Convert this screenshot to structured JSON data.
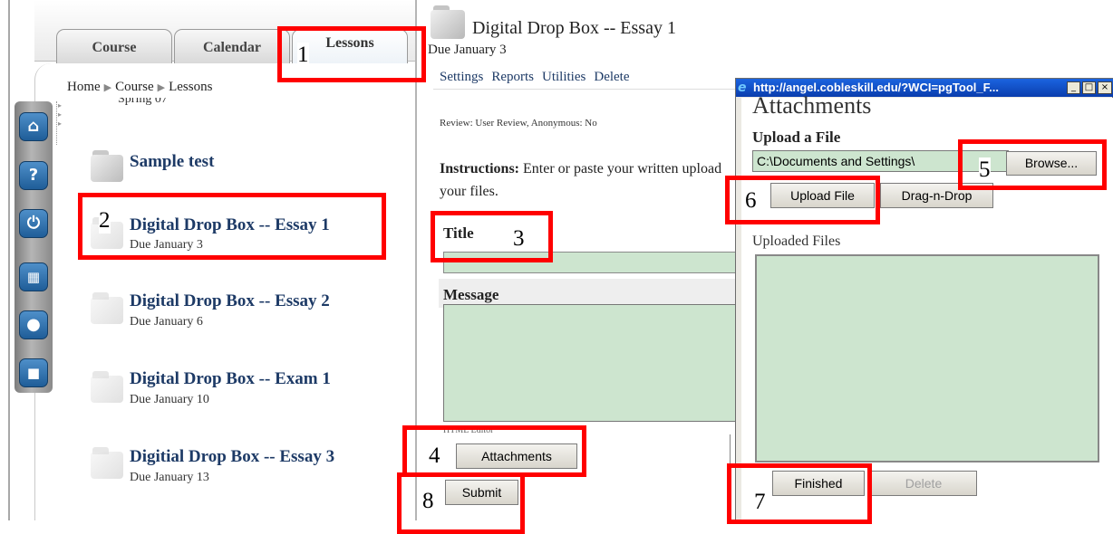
{
  "left": {
    "tabs": [
      {
        "label": "Course"
      },
      {
        "label": "Calendar"
      },
      {
        "label": "Lessons"
      }
    ],
    "breadcrumb": [
      "Home",
      "Course",
      "Lessons"
    ],
    "cut_text": "Spring 07",
    "sidebar_icons": [
      "home-icon",
      "help-icon",
      "power-icon",
      "folder-icon",
      "user-icon",
      "chat-icon"
    ],
    "lessons": [
      {
        "title": "Sample test",
        "due": ""
      },
      {
        "title": "Digital Drop Box -- Essay 1",
        "due": "Due January 3"
      },
      {
        "title": "Digital Drop Box -- Essay 2",
        "due": "Due January 6"
      },
      {
        "title": "Digital Drop Box -- Exam 1",
        "due": "Due January 10"
      },
      {
        "title": "Digitial Drop Box -- Essay 3",
        "due": "Due January 13"
      }
    ]
  },
  "middle": {
    "title": "Digital Drop Box -- Essay 1",
    "due": "Due January 3",
    "menu": [
      "Settings",
      "Reports",
      "Utilities",
      "Delete"
    ],
    "review": "Review: User Review, Anonymous: No",
    "instructions_label": "Instructions:",
    "instructions_text": " Enter or paste your written upload your files.",
    "title_label": "Title",
    "message_label": "Message",
    "html_editor": "HTML Editor",
    "attachments_button": "Attachments",
    "submit_button": "Submit"
  },
  "popup": {
    "url": "http://angel.cobleskill.edu/?WCI=pgTool_F...",
    "heading": "Attachments",
    "upload_label": "Upload a File",
    "file_value": "C:\\Documents and Settings\\",
    "browse_button": "Browse...",
    "upload_button": "Upload File",
    "dragdrop_button": "Drag-n-Drop",
    "uploaded_label": "Uploaded Files",
    "finished_button": "Finished",
    "delete_button": "Delete"
  },
  "steps": [
    "1",
    "2",
    "3",
    "4",
    "5",
    "6",
    "7",
    "8"
  ],
  "colors": {
    "annotation_red": "#ff0000",
    "field_green": "#cde5cf",
    "link_navy": "#1d3a66",
    "titlebar_blue": "#0a3dad"
  }
}
